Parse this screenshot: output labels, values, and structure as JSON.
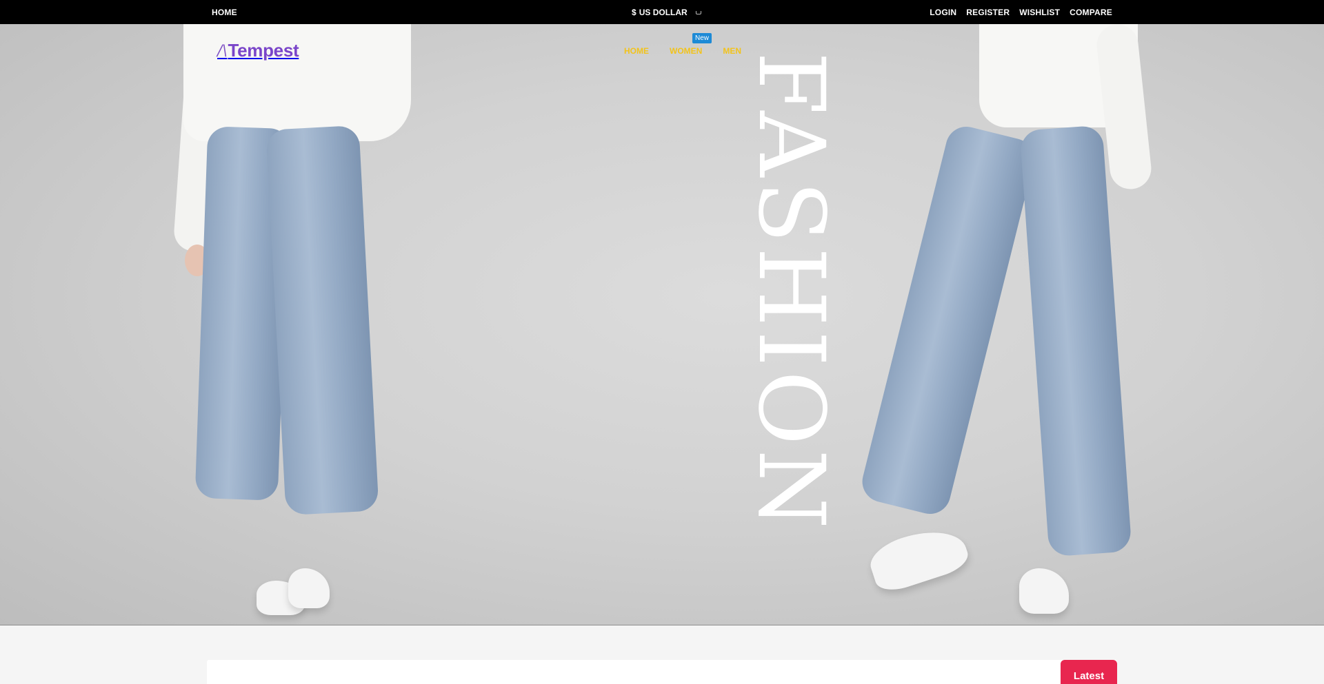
{
  "topbar": {
    "home_link": "HOME",
    "currency": {
      "symbol": "$",
      "label": "US DOLLAR"
    },
    "account_links": [
      "LOGIN",
      "REGISTER",
      "WISHLIST",
      "COMPARE"
    ]
  },
  "header": {
    "logo": {
      "mark": "/\\",
      "text": "Tempest"
    },
    "nav": [
      "HOME",
      "WOMEN",
      "MEN"
    ],
    "nav_badge": "New"
  },
  "hero": {
    "headline": "FASHION"
  },
  "section": {
    "latest_label": "Latest"
  },
  "colors": {
    "topbar_bg": "#000000",
    "logo": "#7a45c9",
    "nav_link": "#f2c31b",
    "badge": "#1d8ad6",
    "accent": "#e8264f"
  }
}
